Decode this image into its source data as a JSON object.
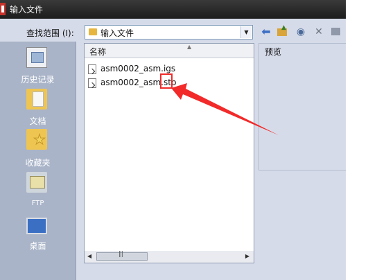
{
  "window": {
    "title": "输入文件"
  },
  "toolbar": {
    "look_in_label": "查找范围 (I):",
    "look_in_value": "输入文件"
  },
  "places": [
    {
      "label": "历史记录",
      "icon": "history-icon"
    },
    {
      "label": "文档",
      "icon": "documents-folder-icon"
    },
    {
      "label": "收藏夹",
      "icon": "favorites-folder-icon"
    },
    {
      "label": "FTP",
      "icon": "ftp-icon"
    },
    {
      "label": "桌面",
      "icon": "desktop-icon"
    }
  ],
  "file_list": {
    "column_header": "名称",
    "files": [
      "asm0002_asm.igs",
      "asm0002_asm.stp"
    ]
  },
  "preview": {
    "label": "预览"
  },
  "annotation": {
    "color": "#f22a2a"
  }
}
